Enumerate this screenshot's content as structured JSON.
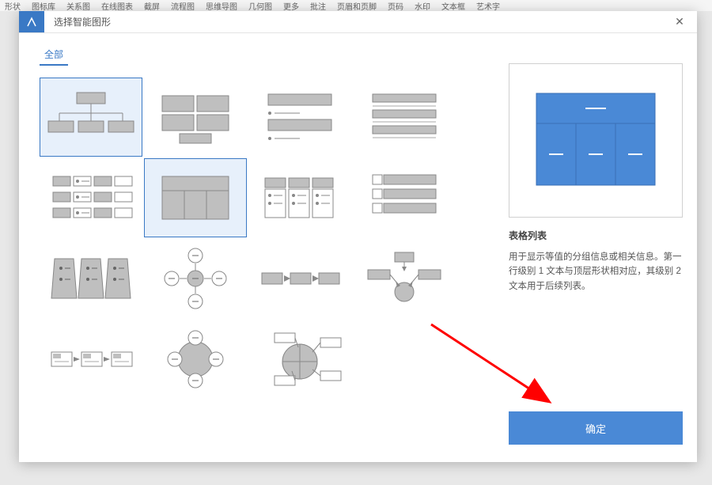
{
  "ribbon": {
    "items": [
      "形状",
      "图标库",
      "关系图",
      "在线图表",
      "截屏",
      "流程图",
      "思维导图",
      "几何图",
      "更多",
      "批注",
      "页眉和页脚",
      "页码",
      "水印",
      "文本框",
      "艺术字"
    ]
  },
  "dialog": {
    "title": "选择智能图形",
    "close_label": "✕",
    "tabs": {
      "all": "全部"
    },
    "ok_label": "确定"
  },
  "gallery": {
    "diagrams": [
      {
        "id": "org-chart",
        "selected": true
      },
      {
        "id": "block-grid",
        "selected": false
      },
      {
        "id": "bullet-list",
        "selected": false
      },
      {
        "id": "header-rows",
        "selected": false
      },
      {
        "id": "two-col-cards",
        "selected": false
      },
      {
        "id": "table-list",
        "selected": true
      },
      {
        "id": "three-cards",
        "selected": false
      },
      {
        "id": "stacked-cards",
        "selected": false
      },
      {
        "id": "pyramid-3d",
        "selected": false
      },
      {
        "id": "radial-plus",
        "selected": false
      },
      {
        "id": "arrow-steps",
        "selected": false
      },
      {
        "id": "hub-spoke",
        "selected": false
      },
      {
        "id": "chain-steps",
        "selected": false
      },
      {
        "id": "circle-ring",
        "selected": false
      },
      {
        "id": "pie-segments",
        "selected": false
      }
    ]
  },
  "preview": {
    "title": "表格列表",
    "description": "用于显示等值的分组信息或相关信息。第一行级别 1 文本与顶层形状相对应，其级别 2 文本用于后续列表。"
  },
  "colors": {
    "accent": "#4a89d6",
    "gray": "#bfbfbf",
    "dgray": "#9a9a9a"
  }
}
